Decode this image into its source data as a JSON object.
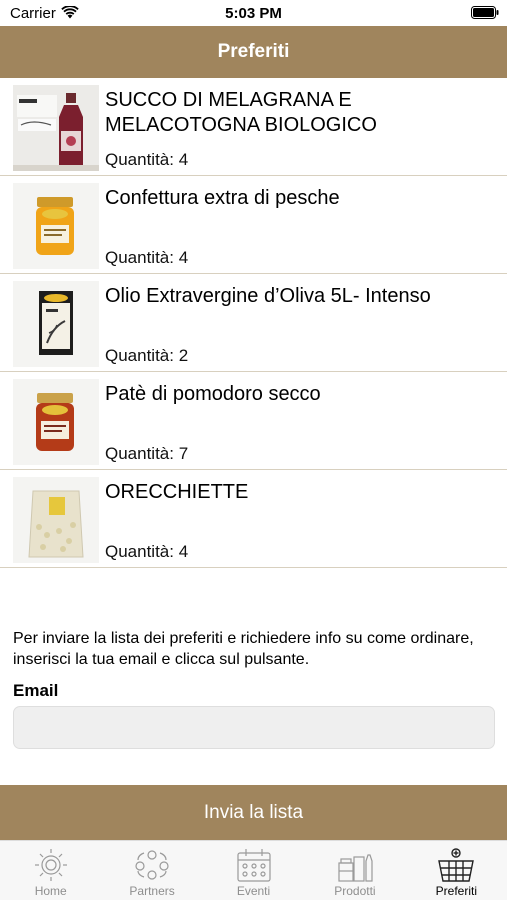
{
  "status": {
    "carrier": "Carrier",
    "time": "5:03 PM"
  },
  "header": {
    "title": "Preferiti"
  },
  "items": [
    {
      "name": "SUCCO DI MELAGRANA E MELACOTOGNA BIOLOGICO",
      "quantity": "Quantità: 4",
      "image": "juice-bottle-image"
    },
    {
      "name": "Confettura extra di pesche",
      "quantity": "Quantità: 4",
      "image": "jam-jar-image"
    },
    {
      "name": "Olio Extravergine d’Oliva 5L- Intenso",
      "quantity": "Quantità: 2",
      "image": "olive-oil-image"
    },
    {
      "name": "Patè di pomodoro secco",
      "quantity": "Quantità: 7",
      "image": "tomato-pate-image"
    },
    {
      "name": "ORECCHIETTE",
      "quantity": "Quantità: 4",
      "image": "pasta-bag-image"
    }
  ],
  "form": {
    "info": "Per inviare la lista dei preferiti e richiedere info su come ordinare, inserisci la tua email e clicca sul pulsante.",
    "email_label": "Email",
    "email_value": "",
    "email_placeholder": "",
    "send_label": "Invia la lista"
  },
  "tabs": [
    {
      "label": "Home",
      "icon": "sun-icon",
      "active": false
    },
    {
      "label": "Partners",
      "icon": "people-icon",
      "active": false
    },
    {
      "label": "Eventi",
      "icon": "calendar-icon",
      "active": false
    },
    {
      "label": "Prodotti",
      "icon": "products-icon",
      "active": false
    },
    {
      "label": "Preferiti",
      "icon": "basket-icon",
      "active": true
    }
  ],
  "colors": {
    "accent": "#a0855d",
    "divider": "#d8d0bf",
    "tab_inactive": "#8e8e8e"
  }
}
